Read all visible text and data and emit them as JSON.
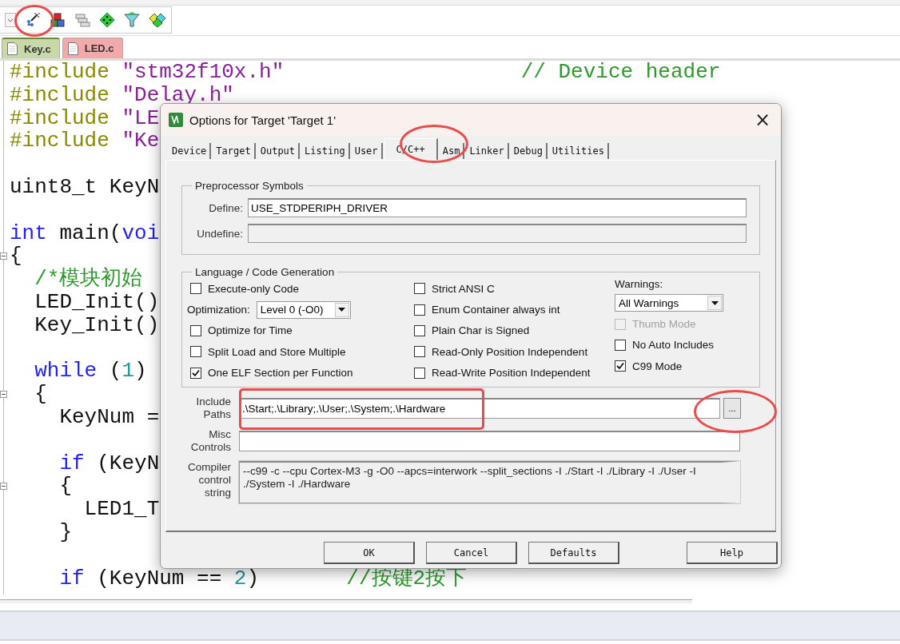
{
  "file_tabs": [
    {
      "label": "Key.c",
      "selected": true,
      "color": "#c9d8a9"
    },
    {
      "label": "LED.c",
      "selected": false,
      "color": "#f2a9a9"
    }
  ],
  "code_lines": [
    {
      "fold": false,
      "tokens": [
        {
          "kind": "directive",
          "text": "#include"
        },
        {
          "kind": "string",
          "text": " \"stm32f10x.h\""
        },
        {
          "kind": "comment",
          "text": "                   // Device header"
        }
      ]
    },
    {
      "fold": false,
      "tokens": [
        {
          "kind": "directive",
          "text": "#include"
        },
        {
          "kind": "string",
          "text": " \"Delay.h\""
        }
      ]
    },
    {
      "fold": false,
      "tokens": [
        {
          "kind": "directive",
          "text": "#include"
        },
        {
          "kind": "string",
          "text": " \"LE"
        }
      ]
    },
    {
      "fold": false,
      "tokens": [
        {
          "kind": "directive",
          "text": "#include"
        },
        {
          "kind": "string",
          "text": " \"Ke"
        }
      ]
    },
    {
      "fold": false
    },
    {
      "fold": false,
      "tokens": [
        {
          "kind": "plain",
          "text": "uint8_t KeyN"
        }
      ]
    },
    {
      "fold": false
    },
    {
      "fold": false,
      "tokens": [
        {
          "kind": "keyword",
          "text": "int"
        },
        {
          "kind": "plain",
          "text": " main("
        },
        {
          "kind": "keyword",
          "text": "voi"
        }
      ]
    },
    {
      "fold": true,
      "tokens": [
        {
          "kind": "plain",
          "text": "{"
        }
      ]
    },
    {
      "fold": false,
      "tokens": [
        {
          "kind": "comment",
          "text": "  /*模块初始"
        }
      ]
    },
    {
      "fold": false,
      "tokens": [
        {
          "kind": "plain",
          "text": "  LED_Init()"
        }
      ]
    },
    {
      "fold": false,
      "tokens": [
        {
          "kind": "plain",
          "text": "  Key_Init()"
        }
      ]
    },
    {
      "fold": false
    },
    {
      "fold": false,
      "tokens": [
        {
          "kind": "keyword",
          "text": "  while"
        },
        {
          "kind": "plain",
          "text": " ("
        },
        {
          "kind": "number",
          "text": "1"
        },
        {
          "kind": "plain",
          "text": ")"
        }
      ]
    },
    {
      "fold": true,
      "tokens": [
        {
          "kind": "plain",
          "text": "  {"
        }
      ]
    },
    {
      "fold": false,
      "tokens": [
        {
          "kind": "plain",
          "text": "    KeyNum ="
        }
      ]
    },
    {
      "fold": false
    },
    {
      "fold": false,
      "tokens": [
        {
          "kind": "keyword",
          "text": "    if"
        },
        {
          "kind": "plain",
          "text": " (KeyN"
        }
      ]
    },
    {
      "fold": true,
      "tokens": [
        {
          "kind": "plain",
          "text": "    {"
        }
      ]
    },
    {
      "fold": false,
      "tokens": [
        {
          "kind": "plain",
          "text": "      LED1_T"
        }
      ]
    },
    {
      "fold": false,
      "tokens": [
        {
          "kind": "plain",
          "text": "    }"
        }
      ]
    },
    {
      "fold": false
    },
    {
      "fold": false,
      "tokens": [
        {
          "kind": "keyword",
          "text": "    if"
        },
        {
          "kind": "plain",
          "text": " (KeyNum == "
        },
        {
          "kind": "number",
          "text": "2"
        },
        {
          "kind": "plain",
          "text": ")"
        },
        {
          "kind": "comment",
          "text": "       //按键2按下"
        }
      ]
    }
  ],
  "dialog": {
    "title": "Options for Target 'Target 1'",
    "close": "×",
    "tabs": [
      {
        "label": "Device",
        "selected": false
      },
      {
        "label": "Target",
        "selected": false
      },
      {
        "label": "Output",
        "selected": false
      },
      {
        "label": "Listing",
        "selected": false
      },
      {
        "label": "User",
        "selected": false
      },
      {
        "label": "C/C++",
        "selected": true
      },
      {
        "label": "Asm",
        "selected": false
      },
      {
        "label": "Linker",
        "selected": false
      },
      {
        "label": "Debug",
        "selected": false
      },
      {
        "label": "Utilities",
        "selected": false
      }
    ],
    "preprocessor": {
      "title": "Preprocessor Symbols",
      "fields": [
        {
          "label": "Define:",
          "value": "USE_STDPERIPH_DRIVER",
          "disabled": false
        },
        {
          "label": "Undefine:",
          "disabled": true
        }
      ]
    },
    "code_generation": {
      "title": "Language / Code Generation",
      "columns": [
        [
          {
            "kind": "checkbox",
            "label": "Execute-only Code",
            "checked": false,
            "disabled": false
          },
          {
            "kind": "select",
            "label": "Optimization:",
            "value": "Level 0 (-O0)"
          },
          {
            "kind": "checkbox",
            "label": "Optimize for Time",
            "checked": false,
            "disabled": false
          },
          {
            "kind": "checkbox",
            "label": "Split Load and Store Multiple",
            "checked": false,
            "disabled": false
          },
          {
            "kind": "checkbox",
            "label": "One ELF Section per Function",
            "checked": true,
            "disabled": false
          }
        ],
        [
          {
            "kind": "checkbox",
            "label": "Strict ANSI C",
            "checked": false,
            "disabled": false
          },
          {
            "kind": "checkbox",
            "label": "Enum Container always int",
            "checked": false,
            "disabled": false
          },
          {
            "kind": "checkbox",
            "label": "Plain Char is Signed",
            "checked": false,
            "disabled": false
          },
          {
            "kind": "checkbox",
            "label": "Read-Only Position Independent",
            "checked": false,
            "disabled": false
          },
          {
            "kind": "checkbox",
            "label": "Read-Write Position Independent",
            "checked": false,
            "disabled": false
          }
        ],
        [
          {
            "kind": "heading",
            "label": "Warnings:"
          },
          {
            "kind": "select",
            "value": "All Warnings"
          },
          {
            "kind": "checkbox",
            "label": "Thumb Mode",
            "checked": false,
            "disabled": true
          },
          {
            "kind": "checkbox",
            "label": "No Auto Includes",
            "checked": false,
            "disabled": false
          },
          {
            "kind": "checkbox",
            "label": "C99 Mode",
            "checked": true,
            "disabled": false
          }
        ]
      ]
    },
    "fields": [
      {
        "label": "Include Paths",
        "value": ".\\Start;.\\Library;.\\User;.\\System;.\\Hardware",
        "disabled": false,
        "browse": "..."
      },
      {
        "label": "Misc Controls",
        "disabled": false
      },
      {
        "label": "Compiler control string",
        "value": "--c99 -c --cpu Cortex-M3 -g -O0 --apcs=interwork --split_sections -I ./Start -I ./Library -I ./User -I ./System -I ./Hardware",
        "disabled": true
      }
    ],
    "buttons": [
      {
        "label": "OK"
      },
      {
        "label": "Cancel"
      },
      {
        "label": "Defaults"
      },
      {
        "label": "Help"
      }
    ]
  }
}
